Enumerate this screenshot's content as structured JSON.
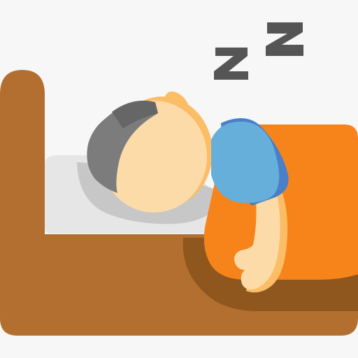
{
  "illustration": {
    "subject": "sleeping-person-icon",
    "colors": {
      "background": "#f7f7f7",
      "bed_frame": "#b36f2f",
      "bed_shadow": "#8f561d",
      "pillow": "#e6e6e6",
      "pillow_shadow": "#c7c7c7",
      "blanket": "#f7841a",
      "skin": "#fddba9",
      "skin_shadow": "#fbbe66",
      "hair": "#7c7c7c",
      "hair_shadow": "#666666",
      "shirt": "#65afda",
      "shirt_shadow": "#4a7fc9",
      "snore_letters": "#555555"
    },
    "icons": [
      "bed-icon",
      "pillow-icon",
      "blanket-icon",
      "person-icon",
      "snore-z-icon"
    ]
  }
}
